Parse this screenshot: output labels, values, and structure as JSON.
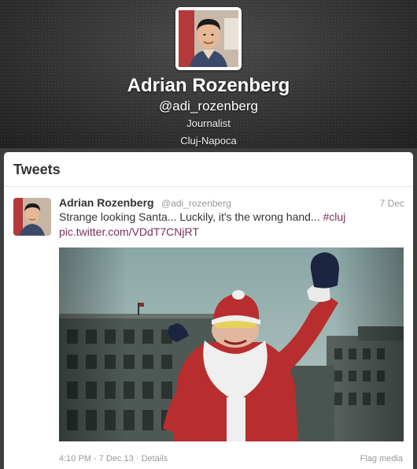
{
  "profile": {
    "name": "Adrian Rozenberg",
    "handle": "@adi_rozenberg",
    "bio": "Journalist",
    "location": "Cluj-Napoca"
  },
  "stream": {
    "title": "Tweets"
  },
  "tweet": {
    "author_name": "Adrian Rozenberg",
    "author_handle": "@adi_rozenberg",
    "date": "7 Dec",
    "text": "Strange looking Santa... Luckily, it's the wrong hand... ",
    "hashtag": "#cluj",
    "link": "pic.twitter.com/VDdT7CNjRT",
    "timestamp": "4:10 PM - 7 Dec 13",
    "details_label": "Details",
    "flag_label": "Flag media"
  },
  "colors": {
    "link": "#7b2f5c",
    "muted": "#999999",
    "header_bg": "#2b2b2b"
  }
}
